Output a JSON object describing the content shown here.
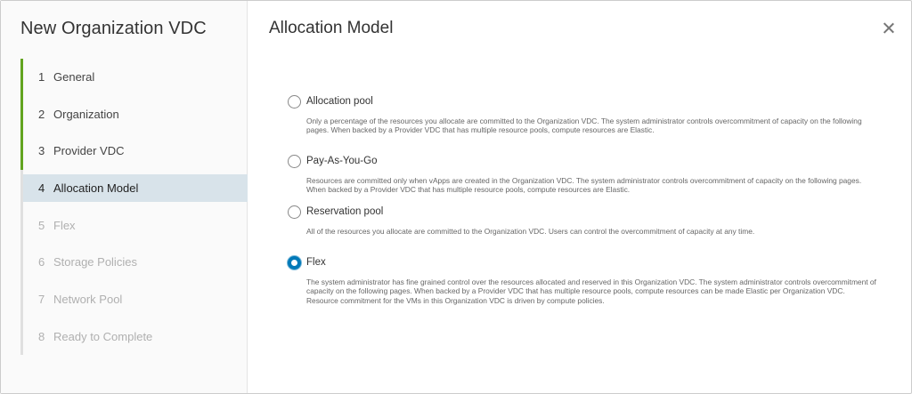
{
  "wizard": {
    "title": "New Organization VDC",
    "steps": [
      {
        "num": "1",
        "label": "General",
        "state": "done"
      },
      {
        "num": "2",
        "label": "Organization",
        "state": "done"
      },
      {
        "num": "3",
        "label": "Provider VDC",
        "state": "done"
      },
      {
        "num": "4",
        "label": "Allocation Model",
        "state": "active"
      },
      {
        "num": "5",
        "label": "Flex",
        "state": "todo"
      },
      {
        "num": "6",
        "label": "Storage Policies",
        "state": "todo"
      },
      {
        "num": "7",
        "label": "Network Pool",
        "state": "todo"
      },
      {
        "num": "8",
        "label": "Ready to Complete",
        "state": "todo"
      }
    ]
  },
  "page": {
    "title": "Allocation Model",
    "close_icon": "close-icon"
  },
  "options": [
    {
      "label": "Allocation pool",
      "selected": false,
      "description": "Only a percentage of the resources you allocate are committed to the Organization VDC. The system administrator controls overcommitment of capacity on the following pages. When backed by a Provider VDC that has multiple resource pools, compute resources are Elastic."
    },
    {
      "label": "Pay-As-You-Go",
      "selected": false,
      "description": "Resources are committed only when vApps are created in the Organization VDC. The system administrator controls overcommitment of capacity on the following pages. When backed by a Provider VDC that has multiple resource pools, compute resources are Elastic."
    },
    {
      "label": "Reservation pool",
      "selected": false,
      "description": "All of the resources you allocate are committed to the Organization VDC. Users can control the overcommitment of capacity at any time."
    },
    {
      "label": "Flex",
      "selected": true,
      "description": "The system administrator has fine grained control over the resources allocated and reserved in this Organization VDC. The system administrator controls overcommitment of capacity on the following pages. When backed by a Provider VDC that has multiple resource pools, compute resources can be made Elastic per Organization VDC. Resource commitment for the VMs in this Organization VDC is driven by compute policies."
    }
  ],
  "colors": {
    "done_track": "#62a420",
    "active_step_bg": "#d8e3ea",
    "radio_selected": "#0079b8"
  }
}
